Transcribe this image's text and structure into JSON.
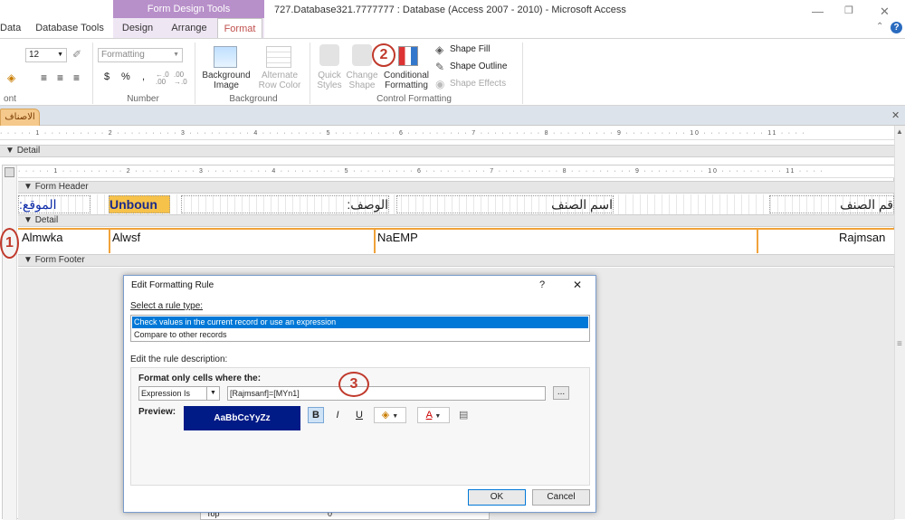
{
  "window": {
    "title": "727.Database321.7777777 : Database (Access 2007 - 2010)  -  Microsoft Access",
    "contextual_band": "Form Design Tools",
    "tabs": [
      "Data",
      "Database Tools",
      "Design",
      "Arrange",
      "Format"
    ],
    "active_tab": "Format"
  },
  "ribbon": {
    "font": {
      "size": "12",
      "group_label": "ont"
    },
    "number": {
      "format": "Formatting",
      "currency": "$",
      "percent": "%",
      "comma": ",",
      "inc_dec": "←.0 .00",
      "dec_dec": ".00 →.0",
      "group_label": "Number"
    },
    "background": {
      "background_image": "Background Image",
      "alternate_row_color": "Alternate Row Color",
      "group_label": "Background"
    },
    "control_formatting": {
      "quick_styles": "Quick Styles",
      "change_shape": "Change Shape",
      "conditional_formatting": "Conditional Formatting",
      "shape_fill": "Shape Fill",
      "shape_outline": "Shape Outline",
      "shape_effects": "Shape Effects",
      "group_label": "Control Formatting"
    }
  },
  "document_tab": "الاصناف",
  "sections": {
    "detail_top": "Detail",
    "form_header": "Form Header",
    "detail": "Detail",
    "form_footer": "Form Footer"
  },
  "header_controls": {
    "location_label": "الموقع:",
    "unbound": "Unboun",
    "description_label": "الوصف:",
    "item_name_label": "اسم الصنف",
    "item_number_label": "قم الصنف"
  },
  "detail_controls": {
    "field1": "Almwka",
    "field2": "Alwsf",
    "field3": "NaEMP",
    "field4": "Rajmsan"
  },
  "annotations": {
    "a1": "1",
    "a2": "2",
    "a3": "3"
  },
  "dialog": {
    "title": "Edit Formatting Rule",
    "help": "?",
    "close": "✕",
    "select_rule_type": "Select a rule type:",
    "rule_types": [
      "Check values in the current record or use an expression",
      "Compare to other records"
    ],
    "edit_rule_description": "Edit the rule description:",
    "format_only": "Format only cells where the:",
    "condition_type": "Expression Is",
    "expression": "[Rajmsanf]=[MYn1]",
    "ellipsis": "...",
    "preview_label": "Preview:",
    "preview_text": "AaBbCcYyZz",
    "bold": "B",
    "italic": "I",
    "underline": "U",
    "ok": "OK",
    "cancel": "Cancel"
  },
  "property_peek": {
    "label": "Top",
    "value": "0"
  },
  "colors": {
    "accent": "#c0504d",
    "preview_bg": "#001a86",
    "selection": "#0078d7"
  }
}
